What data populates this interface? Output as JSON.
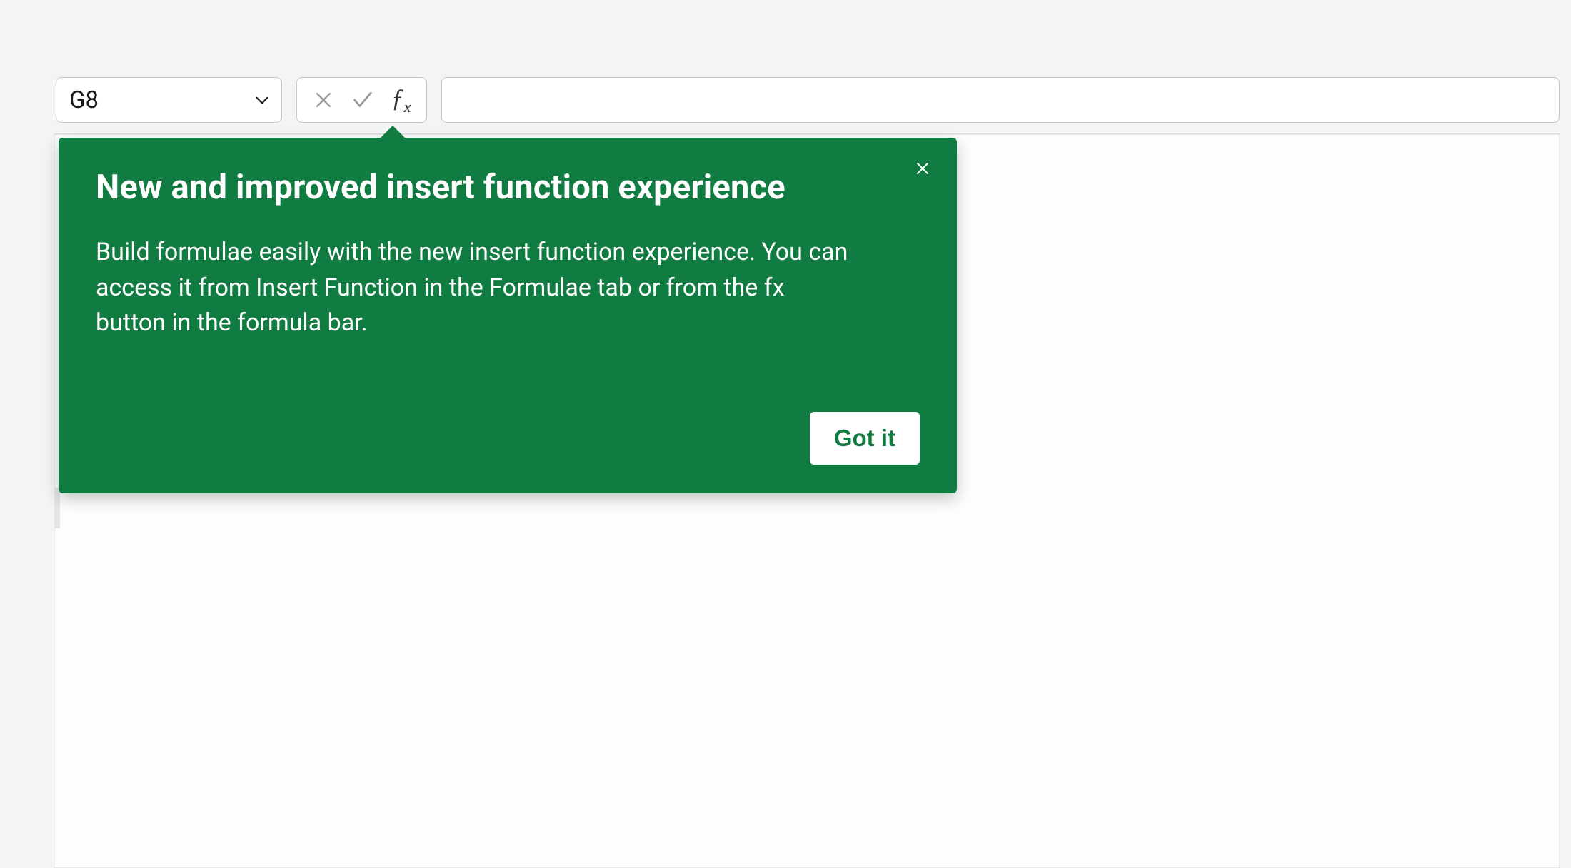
{
  "colors": {
    "accent": "#107c41",
    "page_bg": "#f3f4f6",
    "border": "#c7c7c7"
  },
  "formula_bar": {
    "name_box_value": "G8",
    "cancel_icon": "x-icon",
    "accept_icon": "check-icon",
    "fx_label": "fx",
    "formula_input_value": ""
  },
  "callout": {
    "title": "New and improved insert function experience",
    "body": "Build formulae easily with the new insert function experience. You can access it from Insert Function in the Formulae tab or from the fx button in the formula bar.",
    "close_icon": "close-icon",
    "primary_button_label": "Got it"
  }
}
